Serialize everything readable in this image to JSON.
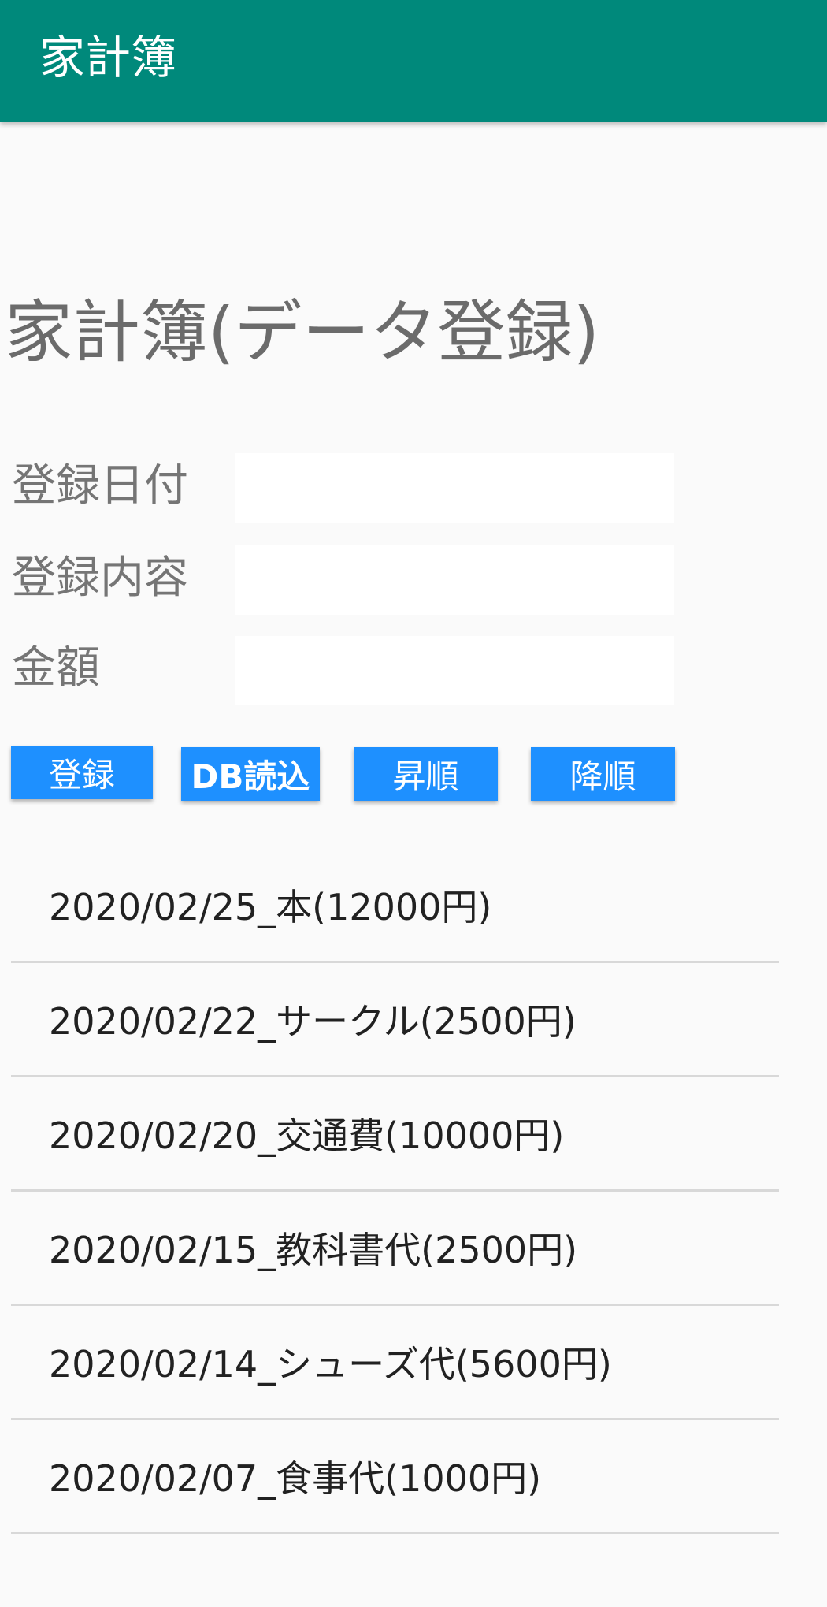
{
  "app_bar": {
    "title": "家計簿"
  },
  "page_title": "家計簿(データ登録)",
  "form": {
    "date_label": "登録日付",
    "date_value": "",
    "content_label": "登録内容",
    "content_value": "",
    "amount_label": "金額",
    "amount_value": ""
  },
  "buttons": {
    "register": "登録",
    "db_load": "DB読込",
    "ascending": "昇順",
    "descending": "降順"
  },
  "colors": {
    "app_bar": "#00897b",
    "button": "#1e90ff",
    "background": "#fafafa"
  },
  "entries": [
    "2020/02/25_本(12000円)",
    "2020/02/22_サークル(2500円)",
    "2020/02/20_交通費(10000円)",
    "2020/02/15_教科書代(2500円)",
    "2020/02/14_シューズ代(5600円)",
    "2020/02/07_食事代(1000円)"
  ]
}
